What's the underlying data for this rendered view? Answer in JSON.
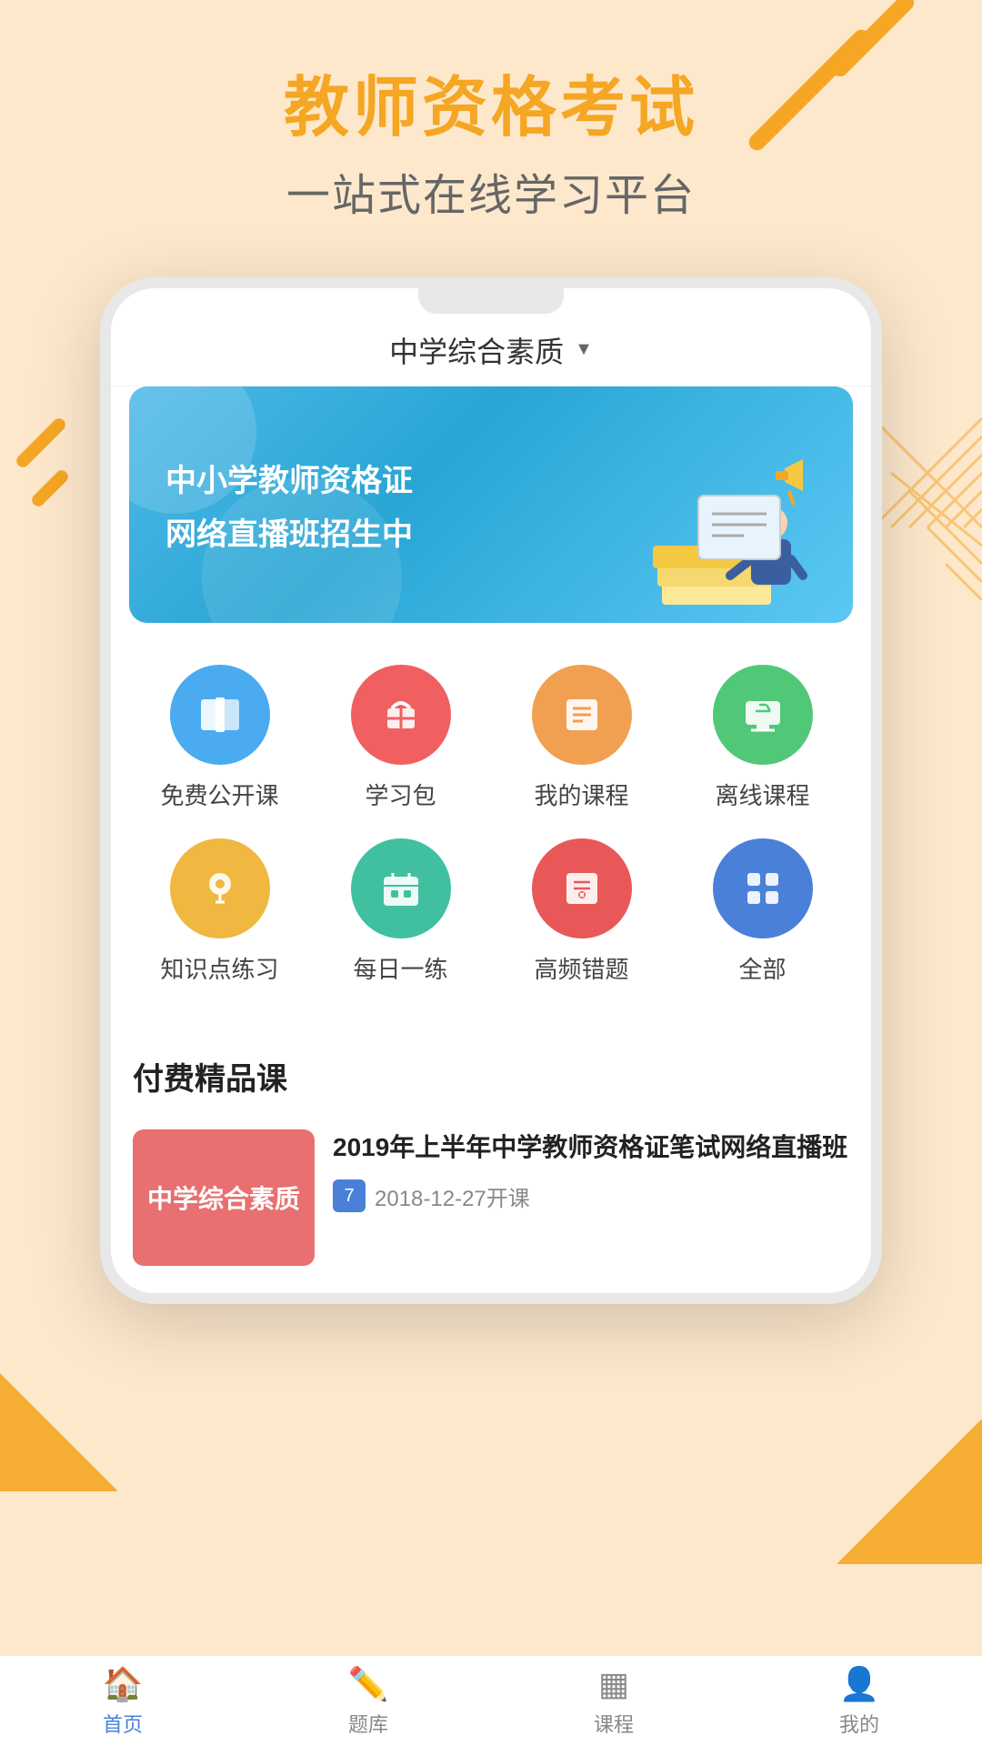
{
  "app": {
    "main_title": "教师资格考试",
    "sub_title": "一站式在线学习平台"
  },
  "phone": {
    "category": {
      "label": "中学综合素质",
      "arrow": "▼"
    },
    "banner": {
      "line1": "中小学教师资格证",
      "line2": "网络直播班招生中"
    },
    "icons": [
      {
        "label": "免费公开课",
        "color_class": "ic-blue",
        "icon": "📚"
      },
      {
        "label": "学习包",
        "color_class": "ic-red",
        "icon": "🎁"
      },
      {
        "label": "我的课程",
        "color_class": "ic-orange",
        "icon": "📋"
      },
      {
        "label": "离线课程",
        "color_class": "ic-green",
        "icon": "🖥"
      },
      {
        "label": "知识点练习",
        "color_class": "ic-yellow",
        "icon": "💡"
      },
      {
        "label": "每日一练",
        "color_class": "ic-green2",
        "icon": "📅"
      },
      {
        "label": "高频错题",
        "color_class": "ic-red2",
        "icon": "✏"
      },
      {
        "label": "全部",
        "color_class": "ic-blue2",
        "icon": "⊞"
      }
    ],
    "section": {
      "title": "付费精品课",
      "course": {
        "thumb_text": "中学综合素质",
        "name": "2019年上半年中学教师资格证笔试网络直播班",
        "date_icon": "7",
        "date": "2018-12-27开课"
      }
    }
  },
  "nav": {
    "items": [
      {
        "label": "首页",
        "icon": "🏠",
        "active": true
      },
      {
        "label": "题库",
        "icon": "✏",
        "active": false
      },
      {
        "label": "课程",
        "icon": "▦",
        "active": false
      },
      {
        "label": "我的",
        "icon": "👤",
        "active": false
      }
    ]
  }
}
